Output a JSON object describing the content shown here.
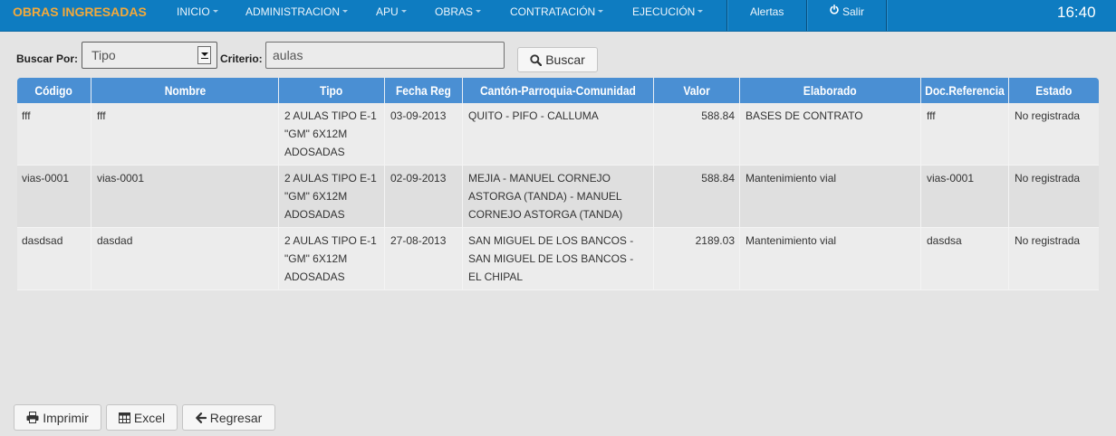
{
  "navbar": {
    "brand": "OBRAS INGRESADAS",
    "menu": [
      {
        "label": "INICIO"
      },
      {
        "label": "ADMINISTRACION"
      },
      {
        "label": "APU"
      },
      {
        "label": "OBRAS"
      },
      {
        "label": "CONTRATACIÓN"
      },
      {
        "label": "EJECUCIÓN"
      }
    ],
    "menu_icon": "caret-down-icon",
    "alerts_label": "Alertas",
    "logout_label": "Salir",
    "logout_icon": "power-icon",
    "clock": "16:40"
  },
  "search": {
    "buscar_por_label": "Buscar Por:",
    "buscar_por_selected": "Tipo",
    "criterio_label": "Criterio:",
    "criterio_value": "aulas",
    "buscar_button": "Buscar",
    "buscar_icon": "search-icon"
  },
  "table": {
    "columns": [
      "Código",
      "Nombre",
      "Tipo",
      "Fecha Reg",
      "Cantón-Parroquia-Comunidad",
      "Valor",
      "Elaborado",
      "Doc.Referencia",
      "Estado"
    ],
    "rows": [
      {
        "codigo": "fff",
        "nombre": "fff",
        "tipo": "2 AULAS TIPO E-1 \"GM\" 6X12M ADOSADAS",
        "fecha_reg": "03-09-2013",
        "canton_parroquia_comunidad": "QUITO - PIFO - CALLUMA",
        "valor": "588.84",
        "elaborado": "BASES DE CONTRATO",
        "doc_referencia": "fff",
        "estado": "No registrada"
      },
      {
        "codigo": "vias-0001",
        "nombre": "vias-0001",
        "tipo": "2 AULAS TIPO E-1 \"GM\" 6X12M ADOSADAS",
        "fecha_reg": "02-09-2013",
        "canton_parroquia_comunidad": "MEJIA - MANUEL CORNEJO ASTORGA (TANDA) - MANUEL CORNEJO ASTORGA (TANDA)",
        "valor": "588.84",
        "elaborado": "Mantenimiento vial",
        "doc_referencia": "vias-0001",
        "estado": "No registrada"
      },
      {
        "codigo": "dasdsad",
        "nombre": "dasdad",
        "tipo": "2 AULAS TIPO E-1 \"GM\" 6X12M ADOSADAS",
        "fecha_reg": "27-08-2013",
        "canton_parroquia_comunidad": "SAN MIGUEL DE LOS BANCOS - SAN MIGUEL DE LOS BANCOS - EL CHIPAL",
        "valor": "2189.03",
        "elaborado": "Mantenimiento vial",
        "doc_referencia": "dasdsa",
        "estado": "No registrada"
      }
    ]
  },
  "actions": {
    "imprimir": {
      "label": "Imprimir",
      "icon": "printer-icon"
    },
    "excel": {
      "label": "Excel",
      "icon": "table-icon"
    },
    "regresar": {
      "label": "Regresar",
      "icon": "arrow-left-icon"
    }
  },
  "colors": {
    "navbar_background": "#0e7cc1",
    "brand_text": "#f2a93b",
    "table_header_background": "#4a8fd3",
    "page_background": "#e4e4e4"
  }
}
